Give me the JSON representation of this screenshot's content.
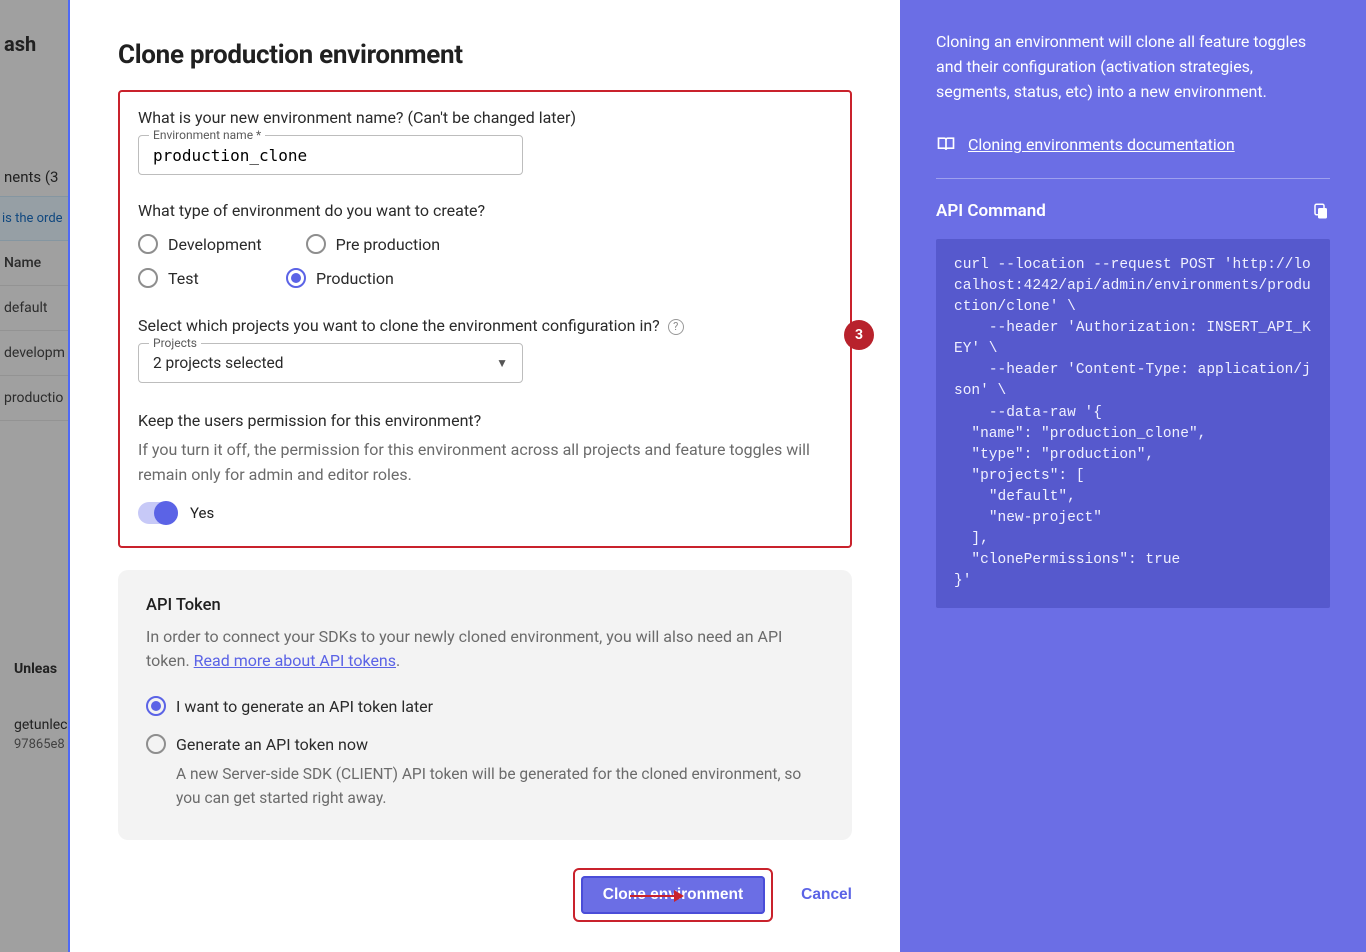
{
  "background": {
    "brand": "ash",
    "heading_fragment": "nents (3",
    "info_banner": "is the orde",
    "col_header": "Name",
    "rows": [
      "default",
      "developm",
      "productio"
    ],
    "footer_title": "Unleas",
    "footer_line1": "getunlec",
    "footer_line2": "97865e8"
  },
  "modal": {
    "title": "Clone production environment",
    "q_name": "What is your new environment name? (Can't be changed later)",
    "name_field_label": "Environment name *",
    "name_value": "production_clone",
    "q_type": "What type of environment do you want to create?",
    "type_options": {
      "development": "Development",
      "preprod": "Pre production",
      "test": "Test",
      "production": "Production"
    },
    "q_projects": "Select which projects you want to clone the environment configuration in?",
    "projects_field_label": "Projects",
    "projects_value": "2 projects selected",
    "q_perm": "Keep the users permission for this environment?",
    "perm_desc": "If you turn it off, the permission for this environment across all projects and feature toggles will remain only for admin and editor roles.",
    "perm_toggle_label": "Yes",
    "step_badge": "3"
  },
  "api_token_card": {
    "title": "API Token",
    "desc_prefix": "In order to connect your SDKs to your newly cloned environment, you will also need an API token. ",
    "link_text": "Read more about API tokens",
    "period": ".",
    "opt_later": "I want to generate an API token later",
    "opt_now": "Generate an API token now",
    "opt_now_desc": "A new Server-side SDK (CLIENT) API token will be generated for the cloned environment, so you can get started right away."
  },
  "footer": {
    "primary": "Clone environment",
    "cancel": "Cancel"
  },
  "sidebar": {
    "desc": "Cloning an environment will clone all feature toggles and their configuration (activation strategies, segments, status, etc) into a new environment.",
    "doc_link": "Cloning environments documentation",
    "api_command_title": "API Command",
    "code": "curl --location --request POST 'http://localhost:4242/api/admin/environments/production/clone' \\\n    --header 'Authorization: INSERT_API_KEY' \\\n    --header 'Content-Type: application/json' \\\n    --data-raw '{\n  \"name\": \"production_clone\",\n  \"type\": \"production\",\n  \"projects\": [\n    \"default\",\n    \"new-project\"\n  ],\n  \"clonePermissions\": true\n}'"
  }
}
